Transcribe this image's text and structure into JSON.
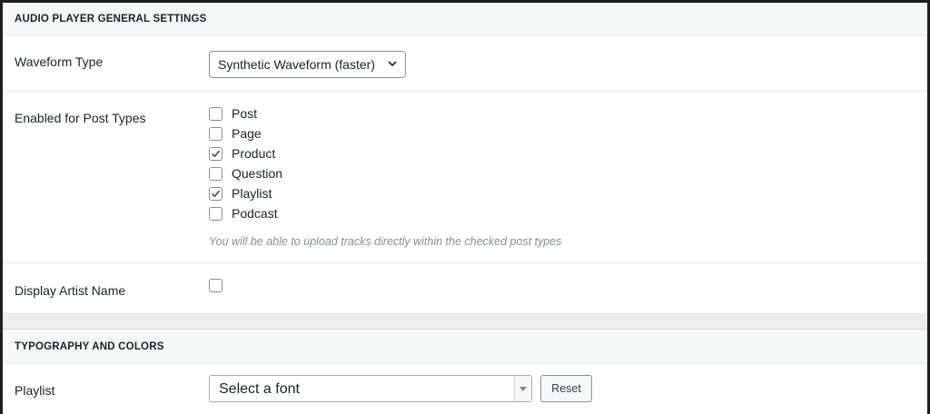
{
  "general": {
    "header": "Audio Player General Settings",
    "waveform": {
      "label": "Waveform Type",
      "selected": "Synthetic Waveform (faster)"
    },
    "post_types": {
      "label": "Enabled for Post Types",
      "options": [
        {
          "label": "Post",
          "checked": false
        },
        {
          "label": "Page",
          "checked": false
        },
        {
          "label": "Product",
          "checked": true
        },
        {
          "label": "Question",
          "checked": false
        },
        {
          "label": "Playlist",
          "checked": true
        },
        {
          "label": "Podcast",
          "checked": false
        }
      ],
      "hint": "You will be able to upload tracks directly within the checked post types"
    },
    "artist_name": {
      "label": "Display Artist Name",
      "checked": false
    }
  },
  "typography": {
    "header": "Typography and Colors",
    "playlist": {
      "label": "Playlist",
      "font_placeholder": "Select a font",
      "reset_label": "Reset"
    }
  }
}
